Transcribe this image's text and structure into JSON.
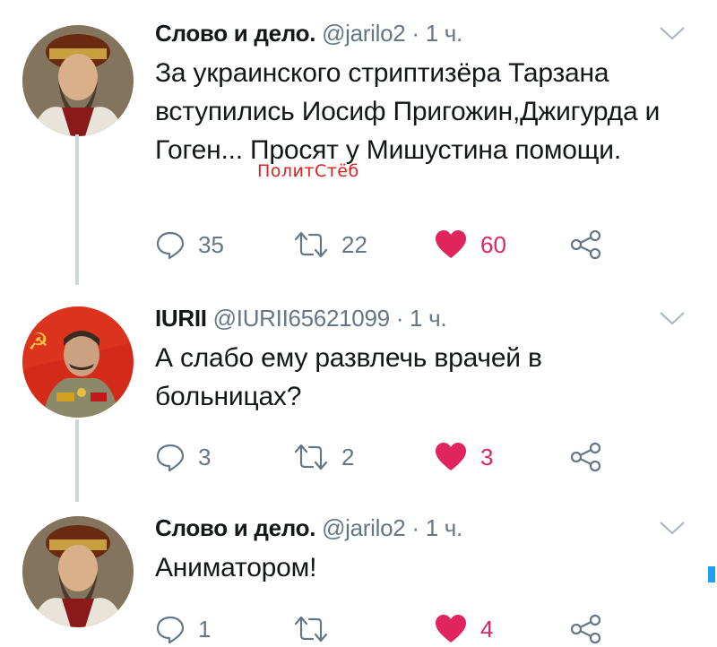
{
  "tweets": [
    {
      "author_name": "Слово и дело.",
      "handle": "@jarilo2",
      "separator": "·",
      "time": "1 ч.",
      "text": "За украинского стриптизёра Тарзана вступились Иосиф Пригожин,Джигурда и Гоген... Просят у Мишустина помощи.",
      "replies": "35",
      "retweets": "22",
      "likes": "60",
      "avatar": "ivan-portrait-avatar"
    },
    {
      "author_name": "IURII",
      "handle": "@IURII65621099",
      "separator": "·",
      "time": "1 ч.",
      "text": "А слабо ему развлечь врачей в больницах?",
      "replies": "3",
      "retweets": "2",
      "likes": "3",
      "avatar": "stalin-portrait-avatar"
    },
    {
      "author_name": "Слово и дело.",
      "handle": "@jarilo2",
      "separator": "·",
      "time": "1 ч.",
      "text": "Аниматором!",
      "replies": "1",
      "retweets": "",
      "likes": "4",
      "avatar": "ivan-portrait-avatar"
    }
  ],
  "watermark": "ПолитСтёб",
  "colors": {
    "like_red": "#e0245e",
    "icon_grey": "#657786",
    "thread_line": "#ccd6dd",
    "accent_blue": "#1da1f2"
  }
}
